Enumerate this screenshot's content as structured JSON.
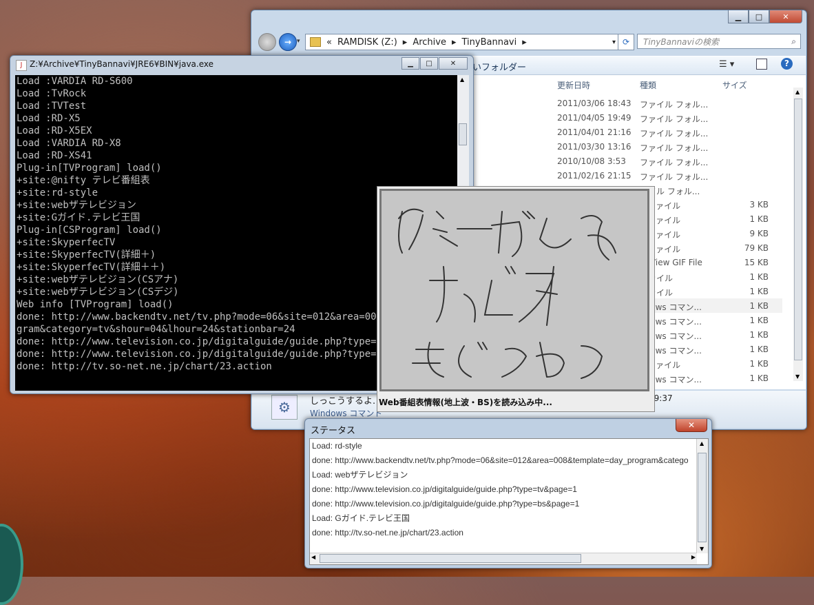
{
  "explorer": {
    "breadcrumb": [
      "«",
      "RAMDISK (Z:)",
      "Archive",
      "TinyBannavi"
    ],
    "search_placeholder": "TinyBannaviの検索",
    "folder_label": "いフォルダー",
    "columns": {
      "date": "更新日時",
      "type": "種類",
      "size": "サイズ"
    },
    "rows": [
      {
        "date": "2011/03/06 18:43",
        "type": "ファイル フォル...",
        "size": ""
      },
      {
        "date": "2011/04/05 19:49",
        "type": "ファイル フォル...",
        "size": ""
      },
      {
        "date": "2011/04/01 21:16",
        "type": "ファイル フォル...",
        "size": ""
      },
      {
        "date": "2011/03/30 13:16",
        "type": "ファイル フォル...",
        "size": ""
      },
      {
        "date": "2010/10/08 3:53",
        "type": "ファイル フォル...",
        "size": ""
      },
      {
        "date": "2011/02/16 21:15",
        "type": "ファイル フォル...",
        "size": ""
      },
      {
        "date": "",
        "type": "ァイル フォル...",
        "size": ""
      },
      {
        "date": "",
        "type": "T ファイル",
        "size": "3 KB"
      },
      {
        "date": "",
        "type": "T ファイル",
        "size": "1 KB"
      },
      {
        "date": "",
        "type": "T ファイル",
        "size": "9 KB"
      },
      {
        "date": "",
        "type": "T ファイル",
        "size": "79 KB"
      },
      {
        "date": "",
        "type": "anView GIF File",
        "size": "15 KB"
      },
      {
        "date": "",
        "type": "ファイル",
        "size": "1 KB"
      },
      {
        "date": "",
        "type": "ファイル",
        "size": "1 KB"
      },
      {
        "date": "",
        "type": "ndows コマン...",
        "size": "1 KB"
      },
      {
        "date": "",
        "type": "ndows コマン...",
        "size": "1 KB"
      },
      {
        "date": "",
        "type": "ndows コマン...",
        "size": "1 KB"
      },
      {
        "date": "",
        "type": "ndows コマン...",
        "size": "1 KB"
      },
      {
        "date": "",
        "type": "T ファイル",
        "size": "1 KB"
      },
      {
        "date": "",
        "type": "ndows コマン...",
        "size": "1 KB"
      }
    ],
    "details": {
      "name": "しっこうするよ.",
      "type": "Windows コマンド",
      "time": "19:37"
    }
  },
  "console": {
    "title": "Z:¥Archive¥TinyBannavi¥JRE6¥BIN¥java.exe",
    "lines": [
      "Load :VARDIA RD-S600",
      "Load :TvRock",
      "Load :TVTest",
      "Load :RD-X5",
      "Load :RD-X5EX",
      "Load :VARDIA RD-X8",
      "Load :RD-XS41",
      "Plug-in[TVProgram] load()",
      "+site:@nifty テレビ番組表",
      "+site:rd-style",
      "+site:webザテレビジョン",
      "+site:Gガイド.テレビ王国",
      "Plug-in[CSProgram] load()",
      "+site:SkyperfecTV",
      "+site:SkyperfecTV(詳細＋)",
      "+site:SkyperfecTV(詳細＋＋)",
      "+site:webザテレビジョン(CSアナ)",
      "+site:webザテレビジョン(CSデジ)",
      "Web info [TVProgram] load()",
      "done: http://www.backendtv.net/tv.php?mode=06&site=012&area=008&te",
      "gram&category=tv&shour=04&lhour=24&stationbar=24",
      "done: http://www.television.co.jp/digitalguide/guide.php?type=tv&p",
      "done: http://www.television.co.jp/digitalguide/guide.php?type=bs&p",
      "done: http://tv.so-net.ne.jp/chart/23.action"
    ]
  },
  "splash": {
    "status": "Web番組表情報(地上波・BS)を読み込み中..."
  },
  "status_window": {
    "title": "ステータス",
    "items": [
      "Load: rd-style",
      "done: http://www.backendtv.net/tv.php?mode=06&site=012&area=008&template=day_program&catego",
      "Load: webザテレビジョン",
      "done: http://www.television.co.jp/digitalguide/guide.php?type=tv&page=1",
      "done: http://www.television.co.jp/digitalguide/guide.php?type=bs&page=1",
      "Load: Gガイド.テレビ王国",
      "done: http://tv.so-net.ne.jp/chart/23.action"
    ]
  }
}
